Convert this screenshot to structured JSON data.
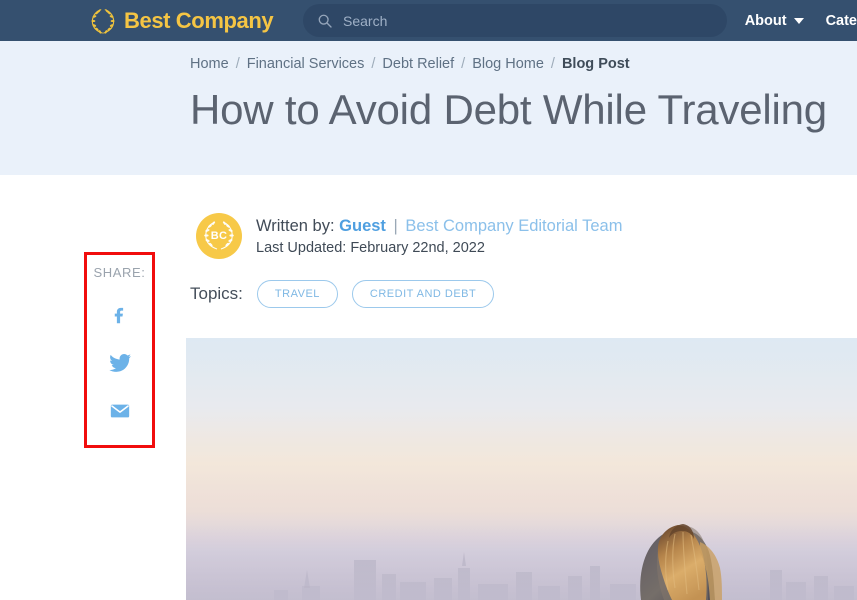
{
  "topbar": {
    "brand_name": "Best Company",
    "brand_icon": "laurel-wreath-icon",
    "search": {
      "placeholder": "Search",
      "value": "",
      "icon": "search-icon"
    },
    "nav": [
      {
        "label": "About",
        "has_dropdown": true,
        "icon": "chevron-down-icon"
      },
      {
        "label": "Cate",
        "has_dropdown": false,
        "truncated": true
      }
    ],
    "background_color": "#35506f",
    "brand_color": "#f5c544"
  },
  "hero": {
    "background_color": "#eaf1fa",
    "breadcrumb": {
      "separator": "/",
      "items": [
        {
          "label": "Home",
          "current": false
        },
        {
          "label": "Financial Services",
          "current": false
        },
        {
          "label": "Debt Relief",
          "current": false
        },
        {
          "label": "Blog Home",
          "current": false
        },
        {
          "label": "Blog Post",
          "current": true
        }
      ]
    },
    "title": "How to Avoid Debt While Traveling"
  },
  "share": {
    "label": "SHARE:",
    "highlight_color": "#f10d0d",
    "icon_color": "#6cb2e8",
    "items": [
      {
        "icon": "facebook-icon",
        "label": "Share on Facebook"
      },
      {
        "icon": "twitter-icon",
        "label": "Share on Twitter"
      },
      {
        "icon": "email-icon",
        "label": "Share by Email"
      }
    ]
  },
  "article": {
    "avatar": {
      "initials": "BC",
      "icon": "laurel-wreath-icon",
      "color": "#f7c948"
    },
    "written_by_label": "Written by:",
    "author": "Guest",
    "separator": "|",
    "team": "Best Company Editorial Team",
    "last_updated": "Last Updated: February 22nd, 2022",
    "topics_label": "Topics:",
    "topics": [
      {
        "label": "TRAVEL"
      },
      {
        "label": "CREDIT AND DEBT"
      }
    ]
  },
  "photo": {
    "alt": "Woman with long blonde hair seen from behind looking out over a hazy city skyline at sunset",
    "sky_top_color": "#dfe9f2",
    "sky_mid_color": "#f5e3d2",
    "haze_color": "#c9c3d4",
    "hair_color": "#c98f4e"
  }
}
